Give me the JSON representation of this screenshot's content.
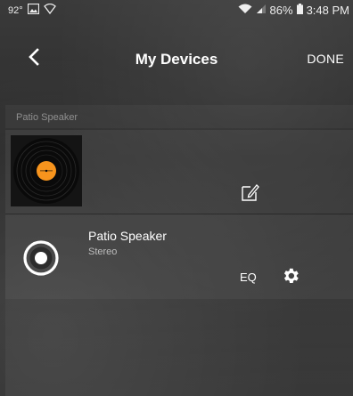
{
  "status_bar": {
    "temperature": "92°",
    "battery_percent": "86%",
    "time": "3:48 PM",
    "icons": [
      "image-icon",
      "vpn-icon",
      "wifi-icon",
      "signal-icon",
      "battery-icon"
    ]
  },
  "header": {
    "title": "My Devices",
    "done_label": "DONE",
    "back_icon": "chevron-left-icon"
  },
  "group": {
    "label": "Patio Speaker",
    "album_art_icon": "vinyl-record-icon",
    "edit_icon": "edit-icon"
  },
  "device": {
    "name": "Patio Speaker",
    "mode": "Stereo",
    "eq_label": "EQ",
    "speaker_icon": "speaker-icon",
    "settings_icon": "gear-icon"
  },
  "colors": {
    "background": "#2c2c2c",
    "text": "#ffffff",
    "muted": "#8f8f8f",
    "record_label": "#f7941d"
  }
}
